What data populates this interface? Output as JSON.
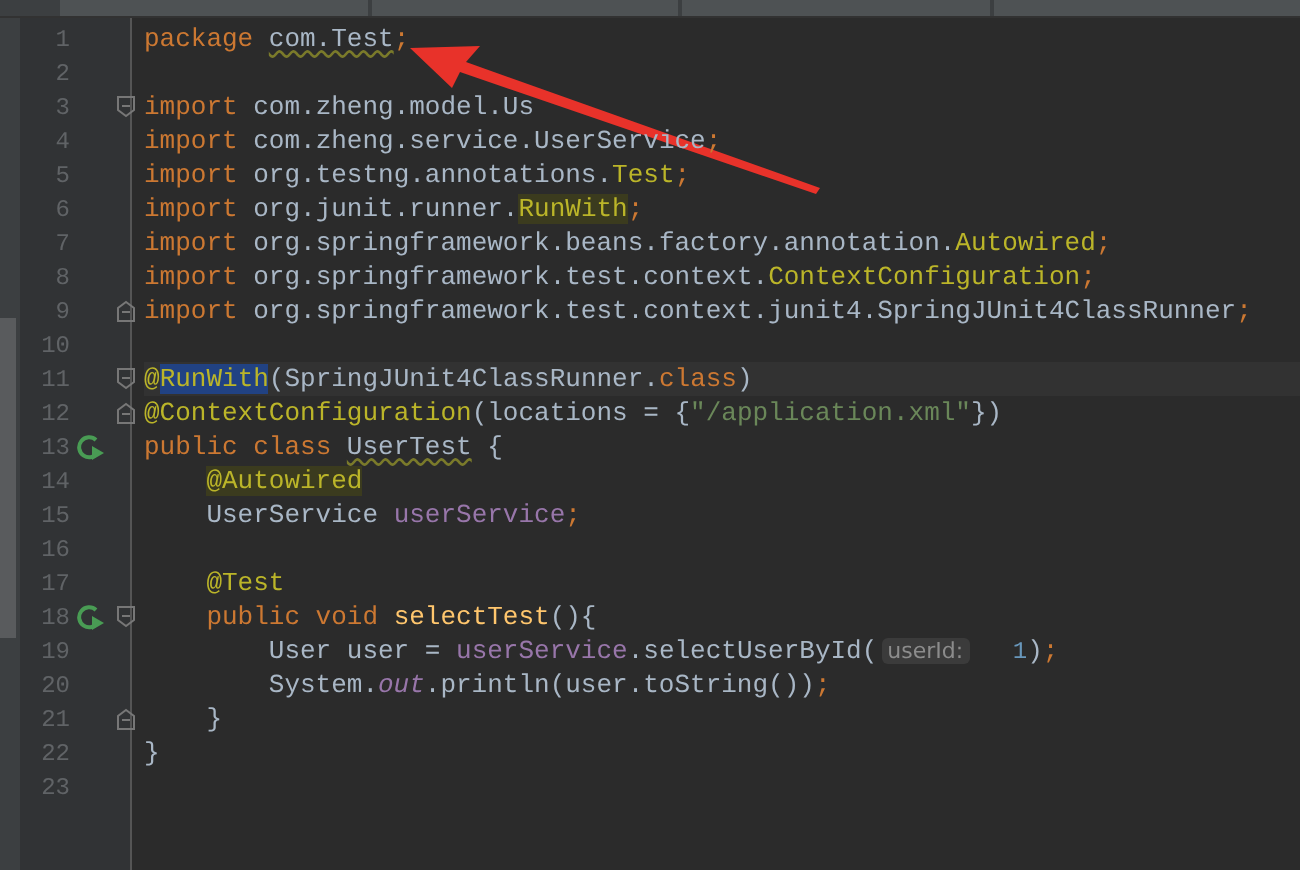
{
  "editor": {
    "lines": [
      {
        "number": "1",
        "tokens": [
          {
            "kind": "kw",
            "text": "package"
          },
          {
            "kind": "typo",
            "text": "com.Test",
            "spaced": true
          },
          {
            "kind": "kw",
            "text": ";"
          }
        ]
      },
      {
        "number": "2"
      },
      {
        "number": "3",
        "fold_start": true,
        "tokens": [
          {
            "kind": "kw",
            "text": "import"
          },
          {
            "kind": "plain",
            "text": "com.zheng.model.Us",
            "spaced": true
          }
        ]
      },
      {
        "number": "4",
        "tokens": [
          {
            "kind": "kw",
            "text": "import"
          },
          {
            "kind": "plain",
            "text": "com.zheng.service.UserService",
            "spaced": true
          },
          {
            "kind": "kw",
            "text": ";"
          }
        ]
      },
      {
        "number": "5",
        "tokens": [
          {
            "kind": "kw",
            "text": "import"
          },
          {
            "kind": "plain",
            "text": "org.testng.annotations.",
            "spaced": true
          },
          {
            "kind": "anno",
            "text": "Test"
          },
          {
            "kind": "kw",
            "text": ";"
          }
        ]
      },
      {
        "number": "6",
        "tokens": [
          {
            "kind": "kw",
            "text": "import"
          },
          {
            "kind": "plain",
            "text": "org.junit.runner.",
            "spaced": true
          },
          {
            "kind": "anno-mark",
            "text": "RunWith"
          },
          {
            "kind": "kw",
            "text": ";"
          }
        ]
      },
      {
        "number": "7",
        "tokens": [
          {
            "kind": "kw",
            "text": "import"
          },
          {
            "kind": "plain",
            "text": "org.springframework.beans.factory.annotation.",
            "spaced": true
          },
          {
            "kind": "anno",
            "text": "Autowired"
          },
          {
            "kind": "kw",
            "text": ";"
          }
        ]
      },
      {
        "number": "8",
        "tokens": [
          {
            "kind": "kw",
            "text": "import"
          },
          {
            "kind": "plain",
            "text": "org.springframework.test.context.",
            "spaced": true
          },
          {
            "kind": "anno",
            "text": "ContextConfiguration"
          },
          {
            "kind": "kw",
            "text": ";"
          }
        ]
      },
      {
        "number": "9",
        "fold_end": true,
        "tokens": [
          {
            "kind": "kw",
            "text": "import"
          },
          {
            "kind": "plain",
            "text": "org.springframework.test.context.junit4.SpringJUnit4ClassRunner",
            "spaced": true
          },
          {
            "kind": "kw",
            "text": ";"
          }
        ]
      },
      {
        "number": "10"
      },
      {
        "number": "11",
        "fold_start": true,
        "current": true,
        "tokens": [
          {
            "kind": "anno",
            "text": "@"
          },
          {
            "kind": "selected",
            "text": "RunWith"
          },
          {
            "kind": "plain",
            "text": "(SpringJUnit4ClassRunner."
          },
          {
            "kind": "kw",
            "text": "class"
          },
          {
            "kind": "plain",
            "text": ")"
          }
        ]
      },
      {
        "number": "12",
        "fold_end": true,
        "tokens": [
          {
            "kind": "anno",
            "text": "@ContextConfiguration"
          },
          {
            "kind": "plain",
            "text": "(locations = {"
          },
          {
            "kind": "str",
            "text": "\"/application.xml\""
          },
          {
            "kind": "plain",
            "text": "})"
          }
        ]
      },
      {
        "number": "13",
        "run": true,
        "tokens": [
          {
            "kind": "kw",
            "text": "public class"
          },
          {
            "kind": "typo",
            "text": "UserTest",
            "spaced": true
          },
          {
            "kind": "plain",
            "text": "{",
            "spaced": true
          }
        ],
        "children": [
          {
            "number": "14",
            "tokens": [
              {
                "kind": "anno-mark",
                "text": "@Autowired"
              }
            ]
          },
          {
            "number": "15",
            "tokens": [
              {
                "kind": "plain",
                "text": "UserService"
              },
              {
                "kind": "field",
                "text": "userService",
                "spaced": true
              },
              {
                "kind": "kw",
                "text": ";"
              }
            ]
          },
          {
            "number": "16"
          },
          {
            "number": "17",
            "tokens": [
              {
                "kind": "anno",
                "text": "@Test"
              }
            ]
          },
          {
            "number": "18",
            "run": true,
            "fold_start": true,
            "tokens": [
              {
                "kind": "kw",
                "text": "public void"
              },
              {
                "kind": "method",
                "text": "selectTest",
                "spaced": true
              },
              {
                "kind": "plain",
                "text": "(){"
              }
            ],
            "children": [
              {
                "number": "19",
                "tokens": [
                  {
                    "kind": "plain",
                    "text": "User user ="
                  },
                  {
                    "kind": "field",
                    "text": "userService",
                    "spaced": true
                  },
                  {
                    "kind": "plain",
                    "text": ".selectUserById("
                  },
                  {
                    "kind": "hint",
                    "text": "userId:"
                  },
                  {
                    "kind": "num",
                    "text": "1"
                  },
                  {
                    "kind": "plain",
                    "text": ")"
                  },
                  {
                    "kind": "kw",
                    "text": ";"
                  }
                ]
              },
              {
                "number": "20",
                "tokens": [
                  {
                    "kind": "plain",
                    "text": "System."
                  },
                  {
                    "kind": "static",
                    "text": "out"
                  },
                  {
                    "kind": "plain",
                    "text": ".println(user.toString())"
                  },
                  {
                    "kind": "kw",
                    "text": ";"
                  }
                ]
              }
            ]
          },
          {
            "number": "21",
            "fold_end": true,
            "tokens": [
              {
                "kind": "plain",
                "text": "}"
              }
            ]
          }
        ]
      },
      {
        "number": "22",
        "tokens": [
          {
            "kind": "plain",
            "text": "}"
          }
        ]
      },
      {
        "number": "23"
      }
    ]
  }
}
